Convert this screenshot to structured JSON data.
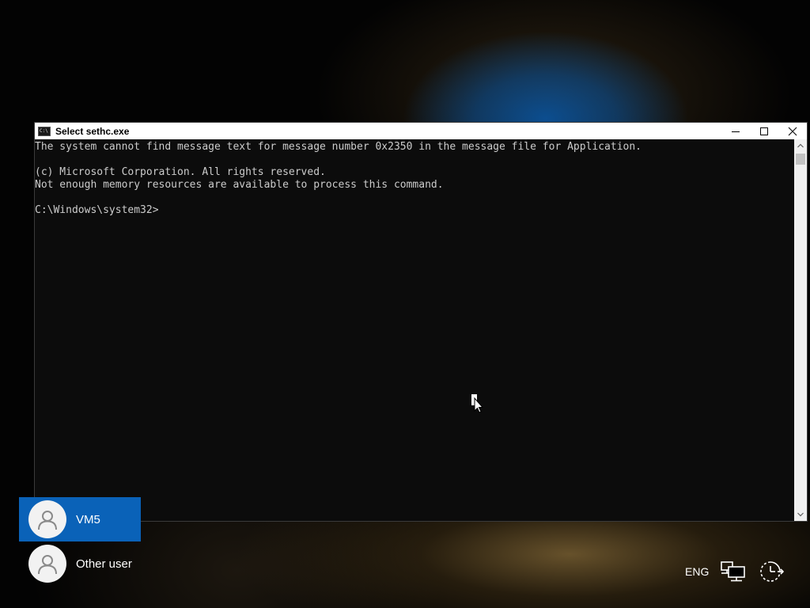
{
  "window": {
    "title": "Select sethc.exe",
    "icon_glyph": "C:\\",
    "controls": {
      "minimize": "minimize-icon",
      "maximize": "maximize-icon",
      "close": "close-icon"
    }
  },
  "console": {
    "lines": [
      "The system cannot find message text for message number 0x2350 in the message file for Application.",
      "",
      "(c) Microsoft Corporation. All rights reserved.",
      "Not enough memory resources are available to process this command.",
      "",
      "C:\\Windows\\system32>"
    ],
    "text_color": "#cccccc",
    "background_color": "#0c0c0c"
  },
  "users": [
    {
      "name": "VM5",
      "selected": true
    },
    {
      "name": "Other user",
      "selected": false
    }
  ],
  "tray": {
    "language": "ENG",
    "network_icon": "network-icon",
    "power_icon": "accessibility-icon"
  },
  "colors": {
    "selected_user_bg": "#0a62b8",
    "titlebar_bg": "#ffffff"
  }
}
